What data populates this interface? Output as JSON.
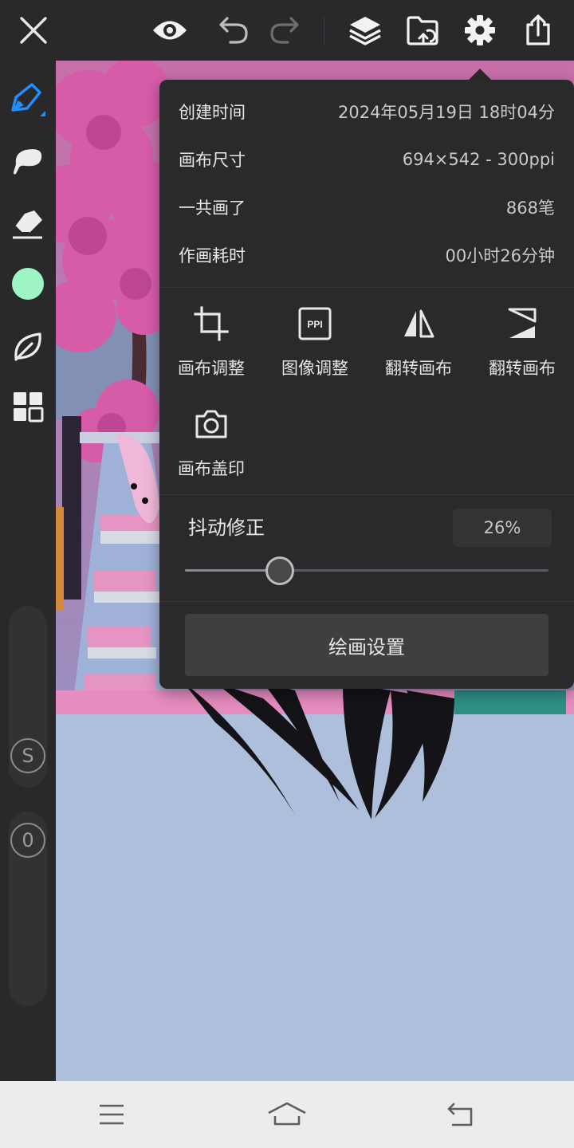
{
  "app": {
    "accent_color": "#1e90ff",
    "current_color": "#9ff5c6",
    "toolbar": {
      "close_icon": "close-icon",
      "preview_icon": "eye-icon",
      "undo_icon": "undo-icon",
      "redo_icon": "redo-icon",
      "layers_icon": "layers-icon",
      "file_icon": "folder-icon",
      "settings_icon": "gear-icon",
      "share_icon": "share-icon"
    },
    "left_tools": [
      "pen-icon",
      "brush-icon",
      "eraser-icon",
      "color-swatch",
      "leaf-icon",
      "grid-icon"
    ],
    "size_slider": {
      "label": "S"
    },
    "opacity_slider": {
      "label": "0"
    }
  },
  "popover": {
    "info": [
      {
        "label": "创建时间",
        "value": "2024年05月19日 18时04分"
      },
      {
        "label": "画布尺寸",
        "value": "694×542 - 300ppi"
      },
      {
        "label": "一共画了",
        "value": "868笔"
      },
      {
        "label": "作画耗时",
        "value": "00小时26分钟"
      }
    ],
    "tools": [
      {
        "label": "画布调整",
        "icon": "crop-icon"
      },
      {
        "label": "图像调整",
        "icon": "ppi-icon",
        "icon_text": "PPI"
      },
      {
        "label": "翻转画布",
        "icon": "flip-horizontal-icon"
      },
      {
        "label": "翻转画布",
        "icon": "flip-vertical-icon"
      },
      {
        "label": "画布盖印",
        "icon": "camera-icon"
      }
    ],
    "stabilization": {
      "label": "抖动修正",
      "value_text": "26%",
      "level": 0.26
    },
    "settings_button": "绘画设置"
  },
  "system_nav": {
    "menu_icon": "menu-icon",
    "home_icon": "home-icon",
    "back_icon": "back-icon"
  }
}
